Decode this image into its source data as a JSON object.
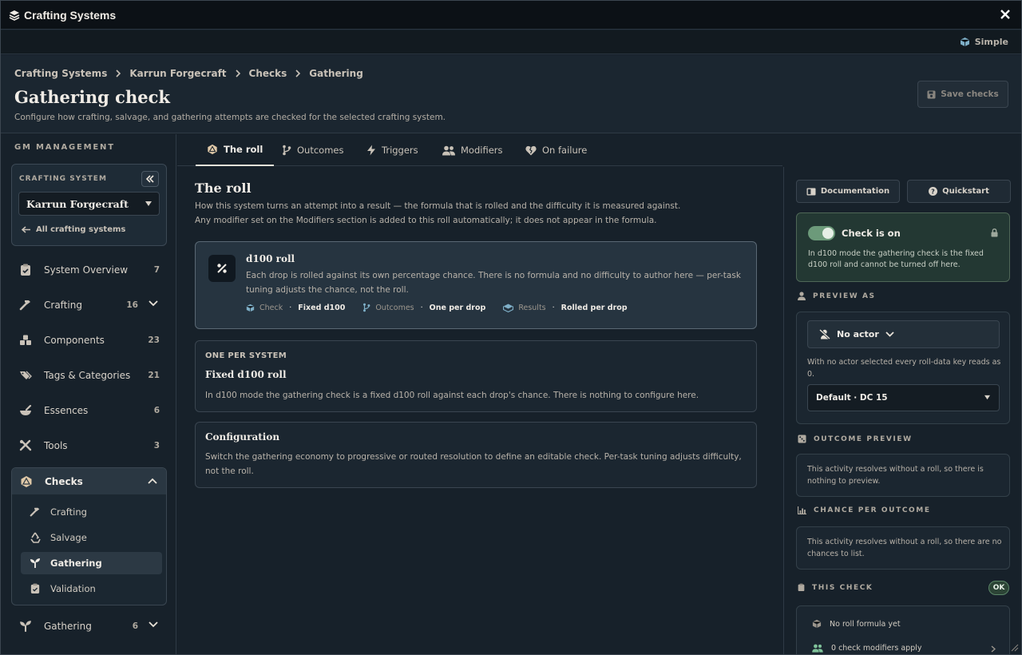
{
  "window": {
    "title": "Crafting Systems",
    "mode_label": "Simple"
  },
  "breadcrumb": [
    "Crafting Systems",
    "Karrun Forgecraft",
    "Checks",
    "Gathering"
  ],
  "header": {
    "title": "Gathering check",
    "subtitle": "Configure how crafting, salvage, and gathering attempts are checked for the selected crafting system.",
    "save_label": "Save checks"
  },
  "sidebar": {
    "section_label": "GM MANAGEMENT",
    "system_label": "CRAFTING SYSTEM",
    "selected_system": "Karrun Forgecraft",
    "all_systems_link": "All crafting systems",
    "items": [
      {
        "label": "System Overview",
        "count": "7"
      },
      {
        "label": "Crafting",
        "count": "16"
      },
      {
        "label": "Components",
        "count": "23"
      },
      {
        "label": "Tags & Categories",
        "count": "21"
      },
      {
        "label": "Essences",
        "count": "6"
      },
      {
        "label": "Tools",
        "count": "3"
      }
    ],
    "checks": {
      "label": "Checks",
      "subitems": [
        "Crafting",
        "Salvage",
        "Gathering",
        "Validation"
      ]
    },
    "gathering": {
      "label": "Gathering",
      "count": "6"
    }
  },
  "tabs": [
    "The roll",
    "Outcomes",
    "Triggers",
    "Modifiers",
    "On failure"
  ],
  "main": {
    "title": "The roll",
    "desc_line1": "How this system turns an attempt into a result — the formula that is rolled and the difficulty it is measured against.",
    "desc_line2": "Any modifier set on the Modifiers section is added to this roll automatically; it does not appear in the formula.",
    "roll_card": {
      "title": "d100 roll",
      "text": "Each drop is rolled against its own percentage chance. There is no formula and no difficulty to author here — per-task tuning adjusts the chance, not the roll.",
      "meta": [
        {
          "key": "Check",
          "value": "Fixed d100"
        },
        {
          "key": "Outcomes",
          "value": "One per drop"
        },
        {
          "key": "Results",
          "value": "Rolled per drop"
        }
      ]
    },
    "system_card": {
      "eyebrow": "ONE PER SYSTEM",
      "title": "Fixed d100 roll",
      "text": "In d100 mode the gathering check is a fixed d100 roll against each drop's chance. There is nothing to configure here."
    },
    "config_card": {
      "title": "Configuration",
      "text": "Switch the gathering economy to progressive or routed resolution to define an editable check. Per-task tuning adjusts difficulty, not the roll."
    }
  },
  "right": {
    "doc_label": "Documentation",
    "quickstart_label": "Quickstart",
    "check_on": {
      "title": "Check is on",
      "text": "In d100 mode the gathering check is the fixed d100 roll and cannot be turned off here."
    },
    "preview_as": {
      "heading": "PREVIEW AS",
      "actor": "No actor",
      "note": "With no actor selected every roll-data key reads as 0.",
      "dc": "Default · DC 15"
    },
    "outcome_preview": {
      "heading": "OUTCOME PREVIEW",
      "text": "This activity resolves without a roll, so there is nothing to preview."
    },
    "chance": {
      "heading": "CHANCE PER OUTCOME",
      "text": "This activity resolves without a roll, so there are no chances to list."
    },
    "this_check": {
      "heading": "THIS CHECK",
      "badge": "OK",
      "line1": "No roll formula yet",
      "line2": "0 check modifiers apply"
    }
  },
  "colors": {
    "accent_green": "#6c9a7a",
    "background": "#17212a"
  }
}
